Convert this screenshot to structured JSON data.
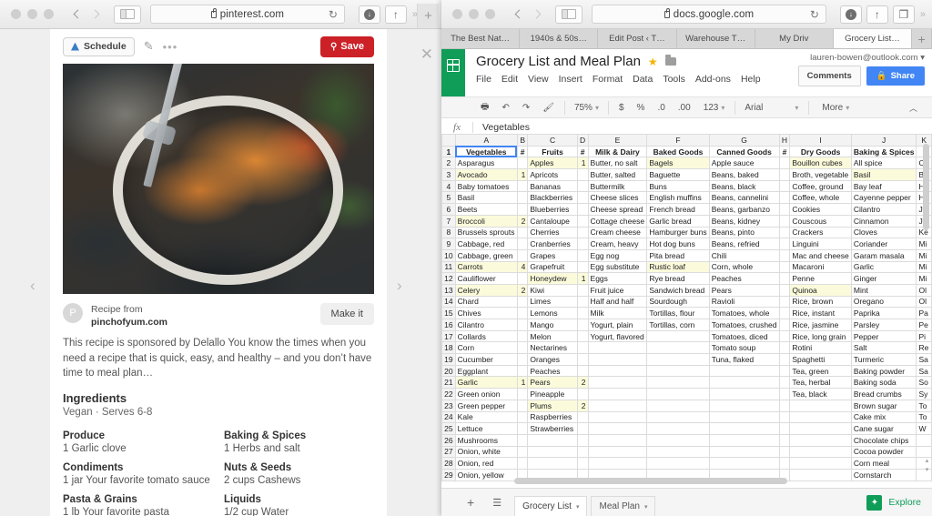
{
  "left_browser": {
    "url": "pinterest.com",
    "icons": {
      "back": "‹",
      "forward": "›",
      "reload": "↻",
      "download": "↓",
      "share": "↑",
      "overflow": "»",
      "newtab": "+"
    }
  },
  "pinterest": {
    "schedule_label": "Schedule",
    "edit_icon": "✎",
    "more_icon": "•••",
    "save_label": "Save",
    "pin_icon": "⚲",
    "avatar_letter": "P",
    "recipe_from_label": "Recipe from",
    "recipe_domain": "pinchofyum.com",
    "make_it_label": "Make it",
    "description": "This recipe is sponsored by Delallo You know the times when you need a recipe that is quick, easy, and healthy – and you don’t have time to meal plan…",
    "ingredients_heading": "Ingredients",
    "ingredients_sub": "Vegan · Serves 6-8",
    "ingredient_groups": [
      {
        "category": "Produce",
        "item": "1 Garlic clove"
      },
      {
        "category": "Baking & Spices",
        "item": "1 Herbs and salt"
      },
      {
        "category": "Condiments",
        "item": "1 jar Your favorite tomato sauce"
      },
      {
        "category": "Nuts & Seeds",
        "item": "2 cups Cashews"
      },
      {
        "category": "Pasta & Grains",
        "item": "1 lb Your favorite pasta"
      },
      {
        "category": "Liquids",
        "item": "1/2 cup Water"
      }
    ],
    "prev_arrow": "‹",
    "next_arrow": "›",
    "close_icon": "✕"
  },
  "right_browser": {
    "url": "docs.google.com",
    "tabs": [
      {
        "label": "The Best Nat…",
        "active": false
      },
      {
        "label": "1940s & 50s…",
        "active": false
      },
      {
        "label": "Edit Post ‹ T…",
        "active": false
      },
      {
        "label": "Warehouse T…",
        "active": false
      },
      {
        "label": "My Driv",
        "active": false
      },
      {
        "label": "Grocery List…",
        "active": true
      }
    ],
    "newtab": "+",
    "icons": {
      "back": "‹",
      "forward": "›",
      "reload": "↻",
      "download": "↓",
      "share": "↑",
      "tabs": "❐",
      "overflow": "»"
    }
  },
  "sheets": {
    "doc_title": "Grocery List and Meal Plan",
    "account": "lauren-bowen@outlook.com",
    "account_caret": "▾",
    "menus": [
      "File",
      "Edit",
      "View",
      "Insert",
      "Format",
      "Data",
      "Tools",
      "Add-ons",
      "Help"
    ],
    "comments_label": "Comments",
    "share_label": "Share",
    "lock_icon": "🔒",
    "toolbar": {
      "print": "🖶",
      "undo": "↶",
      "redo": "↷",
      "paint": "🖌",
      "zoom": "75%",
      "currency": "$",
      "percent": "%",
      "dec_decimal": ".0",
      "inc_decimal": ".00",
      "formats": "123",
      "font": "Arial",
      "more": "More",
      "collapse": "︿"
    },
    "formula_fx": "fx",
    "formula_value": "Vegetables",
    "column_letters": [
      "A",
      "B",
      "C",
      "D",
      "E",
      "F",
      "G",
      "H",
      "I",
      "J",
      "K"
    ],
    "headers": [
      "Vegetables",
      "#",
      "Fruits",
      "#",
      "Milk & Dairy",
      "Baked Goods",
      "Canned Goods",
      "#",
      "Dry Goods",
      "Baking & Spices",
      ""
    ],
    "rows": [
      [
        "Asparagus",
        "",
        "Apples",
        "1",
        "Butter, no salt",
        "Bagels",
        "Apple sauce",
        "",
        "Bouillon cubes",
        "All spice",
        "Ch"
      ],
      [
        "Avocado",
        "1",
        "Apricots",
        "",
        "Butter, salted",
        "Baguette",
        "Beans, baked",
        "",
        "Broth, vegetable",
        "Basil",
        "BB"
      ],
      [
        "Baby tomatoes",
        "",
        "Bananas",
        "",
        "Buttermilk",
        "Buns",
        "Beans, black",
        "",
        "Coffee, ground",
        "Bay leaf",
        "Ho"
      ],
      [
        "Basil",
        "",
        "Blackberries",
        "",
        "Cheese slices",
        "English muffins",
        "Beans, cannelini",
        "",
        "Coffee, whole",
        "Cayenne pepper",
        "Ho"
      ],
      [
        "Beets",
        "",
        "Blueberries",
        "",
        "Cheese spread",
        "French bread",
        "Beans, garbanzo",
        "",
        "Cookies",
        "Cilantro",
        "Ja"
      ],
      [
        "Broccoli",
        "2",
        "Cantaloupe",
        "",
        "Cottage cheese",
        "Garlic bread",
        "Beans, kidney",
        "",
        "Couscous",
        "Cinnamon",
        "Je"
      ],
      [
        "Brussels sprouts",
        "",
        "Cherries",
        "",
        "Cream cheese",
        "Hamburger buns",
        "Beans, pinto",
        "",
        "Crackers",
        "Cloves",
        "Ke"
      ],
      [
        "Cabbage, red",
        "",
        "Cranberries",
        "",
        "Cream, heavy",
        "Hot dog buns",
        "Beans, refried",
        "",
        "Linguini",
        "Coriander",
        "Mi"
      ],
      [
        "Cabbage, green",
        "",
        "Grapes",
        "",
        "Egg nog",
        "Pita bread",
        "Chili",
        "",
        "Mac and cheese",
        "Garam masala",
        "Mi"
      ],
      [
        "Carrots",
        "4",
        "Grapefruit",
        "",
        "Egg substitute",
        "Rustic loaf",
        "Corn, whole",
        "",
        "Macaroni",
        "Garlic",
        "Mi"
      ],
      [
        "Cauliflower",
        "",
        "Honeydew",
        "1",
        "Eggs",
        "Rye bread",
        "Peaches",
        "",
        "Penne",
        "Ginger",
        "Mi"
      ],
      [
        "Celery",
        "2",
        "Kiwi",
        "",
        "Fruit juice",
        "Sandwich bread",
        "Pears",
        "",
        "Quinoa",
        "Mint",
        "Ol"
      ],
      [
        "Chard",
        "",
        "Limes",
        "",
        "Half and half",
        "Sourdough",
        "Ravioli",
        "",
        "Rice, brown",
        "Oregano",
        "Ol"
      ],
      [
        "Chives",
        "",
        "Lemons",
        "",
        "Milk",
        "Tortillas, flour",
        "Tomatoes, whole",
        "",
        "Rice, instant",
        "Paprika",
        "Pa"
      ],
      [
        "Cilantro",
        "",
        "Mango",
        "",
        "Yogurt, plain",
        "Tortillas, corn",
        "Tomatoes, crushed",
        "",
        "Rice, jasmine",
        "Parsley",
        "Pe"
      ],
      [
        "Collards",
        "",
        "Melon",
        "",
        "Yogurt, flavored",
        "",
        "Tomatoes, diced",
        "",
        "Rice, long grain",
        "Pepper",
        "Pi"
      ],
      [
        "Corn",
        "",
        "Nectarines",
        "",
        "",
        "",
        "Tomato soup",
        "",
        "Rotini",
        "Salt",
        "Re"
      ],
      [
        "Cucumber",
        "",
        "Oranges",
        "",
        "",
        "",
        "Tuna, flaked",
        "",
        "Spaghetti",
        "Turmeric",
        "Sa"
      ],
      [
        "Eggplant",
        "",
        "Peaches",
        "",
        "",
        "",
        "",
        "",
        "Tea, green",
        "Baking powder",
        "Sa"
      ],
      [
        "Garlic",
        "1",
        "Pears",
        "2",
        "",
        "",
        "",
        "",
        "Tea, herbal",
        "Baking soda",
        "So"
      ],
      [
        "Green onion",
        "",
        "Pineapple",
        "",
        "",
        "",
        "",
        "",
        "Tea, black",
        "Bread crumbs",
        "Sy"
      ],
      [
        "Green pepper",
        "",
        "Plums",
        "2",
        "",
        "",
        "",
        "",
        "",
        "Brown sugar",
        "To"
      ],
      [
        "Kale",
        "",
        "Raspberries",
        "",
        "",
        "",
        "",
        "",
        "",
        "Cake mix",
        "To"
      ],
      [
        "Lettuce",
        "",
        "Strawberries",
        "",
        "",
        "",
        "",
        "",
        "",
        "Cane sugar",
        "W"
      ],
      [
        "Mushrooms",
        "",
        "",
        "",
        "",
        "",
        "",
        "",
        "",
        "Chocolate chips",
        ""
      ],
      [
        "Onion, white",
        "",
        "",
        "",
        "",
        "",
        "",
        "",
        "",
        "Cocoa powder",
        ""
      ],
      [
        "Onion, red",
        "",
        "",
        "",
        "",
        "",
        "",
        "",
        "",
        "Corn meal",
        ""
      ],
      [
        "Onion, yellow",
        "",
        "",
        "",
        "",
        "",
        "",
        "",
        "",
        "Cornstarch",
        ""
      ]
    ],
    "highlighted_cells": [
      [
        0,
        2
      ],
      [
        0,
        3
      ],
      [
        0,
        5
      ],
      [
        0,
        8
      ],
      [
        1,
        0
      ],
      [
        1,
        1
      ],
      [
        1,
        9
      ],
      [
        5,
        0
      ],
      [
        5,
        1
      ],
      [
        9,
        0
      ],
      [
        9,
        1
      ],
      [
        9,
        5
      ],
      [
        10,
        2
      ],
      [
        10,
        3
      ],
      [
        11,
        0
      ],
      [
        11,
        1
      ],
      [
        11,
        8
      ],
      [
        19,
        0
      ],
      [
        19,
        1
      ],
      [
        19,
        2
      ],
      [
        19,
        3
      ],
      [
        21,
        2
      ],
      [
        21,
        3
      ]
    ],
    "bottom": {
      "add_sheet": "+",
      "all_sheets": "☰",
      "sheet_tabs": [
        {
          "label": "Grocery List",
          "active": true
        },
        {
          "label": "Meal Plan",
          "active": false
        }
      ],
      "explore_label": "Explore",
      "explore_icon": "✦"
    }
  }
}
